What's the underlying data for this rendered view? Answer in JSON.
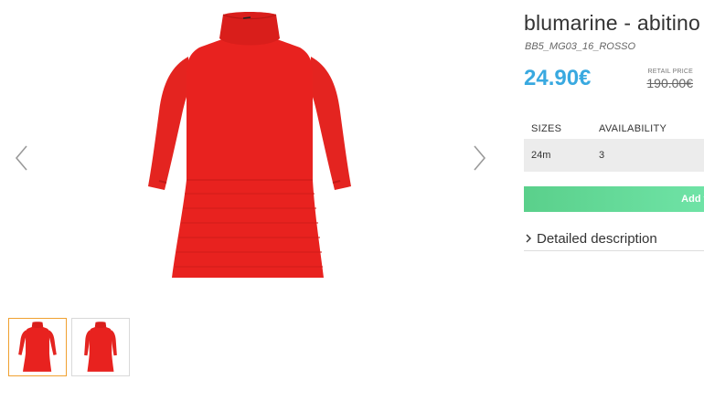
{
  "product": {
    "title": "blumarine - abitino",
    "sku": "BB5_MG03_16_ROSSO",
    "price": "24.90€",
    "retail_label": "RETAIL PRICE",
    "retail_price": "190.00€"
  },
  "sizes_table": {
    "headers": [
      "SIZES",
      "AVAILABILITY"
    ],
    "rows": [
      {
        "size": "24m",
        "availability": "3"
      }
    ]
  },
  "add_button_label": "Add to",
  "details_label": "Detailed description",
  "colors": {
    "price": "#39a9e0",
    "add_button": "#5ad08b",
    "dress": "#e8221f",
    "active_thumb_border": "#f0a030"
  },
  "icons": {
    "prev": "chevron-left-icon",
    "next": "chevron-right-icon",
    "details": "chevron-right-icon"
  }
}
